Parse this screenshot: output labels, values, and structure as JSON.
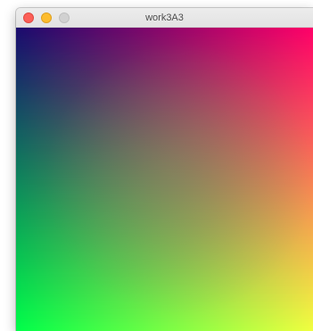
{
  "window": {
    "title": "work3A3"
  },
  "canvas": {
    "corner_colors": {
      "top_left": "#1a0a6e",
      "top_right": "#ff0068",
      "bottom_left": "#00ff4a",
      "bottom_right": "#f0ff40"
    },
    "mid_color": "#7a8a66"
  },
  "icons": {
    "close": "close-icon",
    "minimize": "minimize-icon",
    "zoom": "zoom-icon"
  }
}
